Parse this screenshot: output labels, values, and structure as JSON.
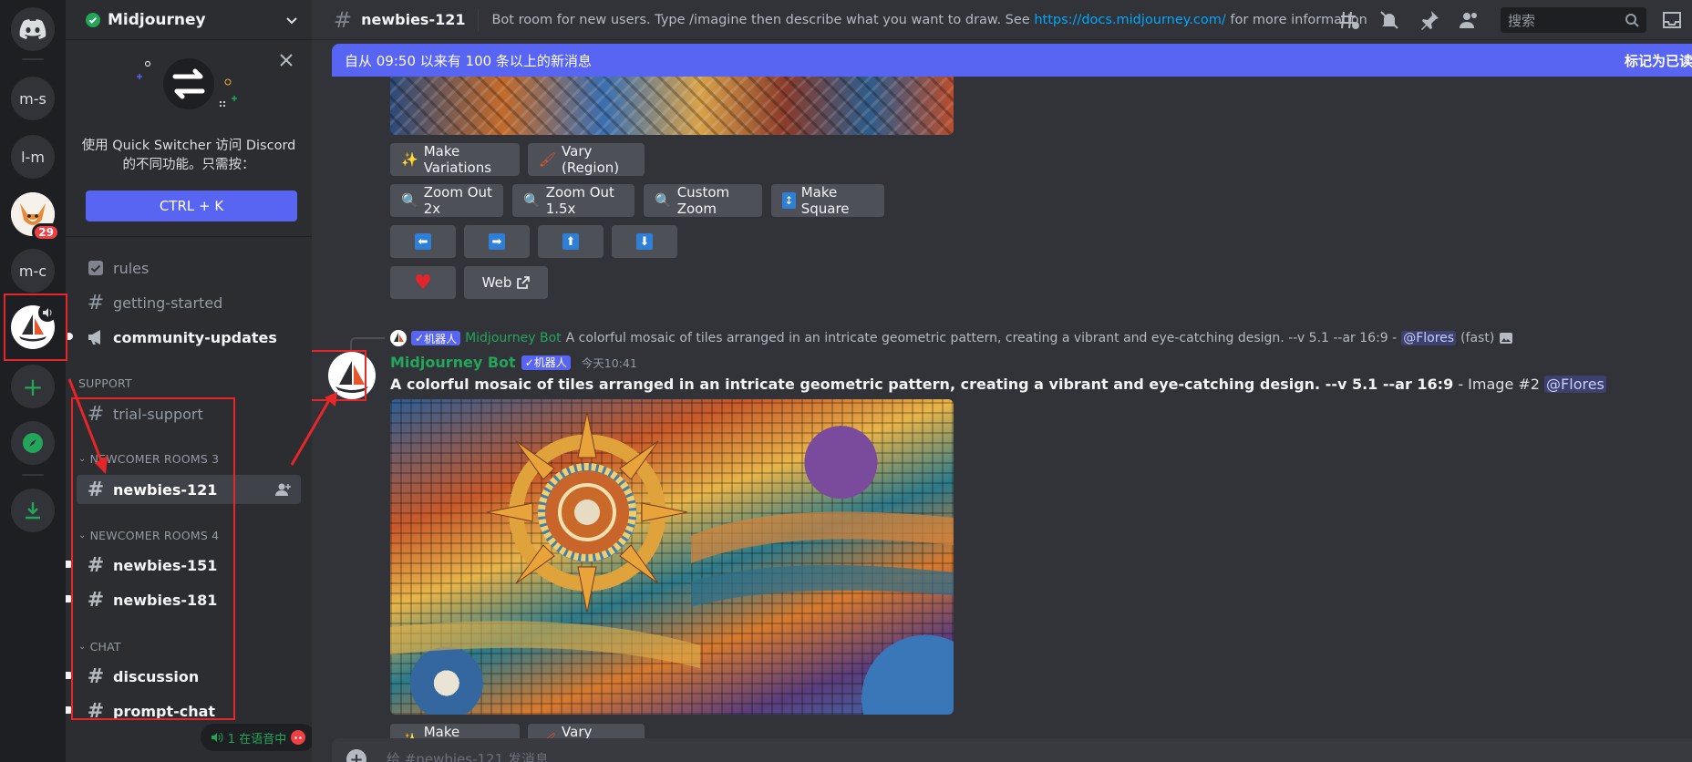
{
  "server_rail": {
    "items": [
      {
        "label": "",
        "icon": "discord-logo-icon"
      },
      {
        "label": "m-s"
      },
      {
        "label": "l-m"
      },
      {
        "label": "",
        "badge": "29",
        "icon": "fox-avatar-icon"
      },
      {
        "label": "m-c"
      },
      {
        "label": "",
        "icon": "midjourney-ship-icon"
      },
      {
        "label": "",
        "icon": "add-server-icon"
      },
      {
        "label": "",
        "icon": "explore-compass-icon"
      },
      {
        "label": "",
        "icon": "download-icon"
      }
    ]
  },
  "sidebar": {
    "server_name": "Midjourney",
    "quick_switcher": {
      "text": "使用 Quick Switcher 访问 Discord 的不同功能。只需按：",
      "shortcut": "CTRL + K"
    },
    "channels_top": [
      {
        "name": "rules",
        "icon": "rules-check-icon"
      },
      {
        "name": "getting-started",
        "icon": "hash-icon"
      },
      {
        "name": "community-updates",
        "icon": "megaphone-icon",
        "unread": true
      }
    ],
    "categories": [
      {
        "name": "SUPPORT",
        "channels": [
          {
            "name": "trial-support"
          }
        ]
      },
      {
        "name": "NEWCOMER ROOMS 3",
        "channels": [
          {
            "name": "newbies-121",
            "selected": true
          }
        ]
      },
      {
        "name": "NEWCOMER ROOMS 4",
        "channels": [
          {
            "name": "newbies-151"
          },
          {
            "name": "newbies-181"
          }
        ]
      },
      {
        "name": "CHAT",
        "channels": [
          {
            "name": "discussion"
          },
          {
            "name": "prompt-chat"
          }
        ]
      }
    ],
    "voice_status": "1 在语音中"
  },
  "header": {
    "channel_name": "newbies-121",
    "topic_prefix": "Bot room for new users. Type /imagine then describe what you want to draw. See",
    "topic_link": "https://docs.midjourney.com/",
    "topic_suffix": "for more information",
    "search_placeholder": "搜索"
  },
  "new_messages_bar": {
    "text": "自从 09:50 以来有 100 条以上的新消息",
    "mark_read": "标记为已读"
  },
  "message_buttons": {
    "make_variations": "Make Variations",
    "vary_region": "Vary (Region)",
    "zoom_out_2x": "Zoom Out 2x",
    "zoom_out_15x": "Zoom Out 1.5x",
    "custom_zoom": "Custom Zoom",
    "make_square": "Make Square",
    "web": "Web"
  },
  "message": {
    "reply_author": "Midjourney Bot",
    "reply_text": "A colorful mosaic of tiles arranged in an intricate geometric pattern, creating a vibrant and eye-catching design. --v 5.1 --ar 16:9 -",
    "reply_mention": "@Flores",
    "reply_speed": "(fast)",
    "bot_tag": "机器人",
    "author": "Midjourney Bot",
    "timestamp": "今天10:41",
    "prompt": "A colorful mosaic of tiles arranged in an intricate geometric pattern, creating a vibrant and eye-catching design. --v 5.1 --ar 16:9",
    "image_label": "- Image #2",
    "mention": "@Flores"
  },
  "composer": {
    "placeholder": "给 #newbies-121 发消息"
  },
  "colors": {
    "accent": "#5865f2",
    "bot_name": "#23a55a",
    "annotation_red": "#e8262a"
  }
}
